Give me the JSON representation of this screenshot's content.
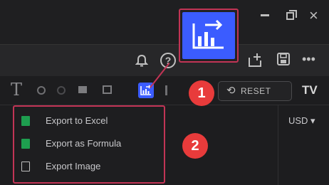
{
  "window": {
    "close_glyph": "×"
  },
  "actions": {
    "help_glyph": "?",
    "more_glyph": "•••"
  },
  "toolbar": {
    "text_tool_glyph": "T",
    "reset_icon_glyph": "⟲",
    "reset_label": "RESET",
    "logo_text": "TV"
  },
  "panel": {
    "currency_label": "USD ▾"
  },
  "export_menu": {
    "items": [
      {
        "label": "Export to Excel",
        "icon": "excel-icon"
      },
      {
        "label": "Export as Formula",
        "icon": "excel-icon"
      },
      {
        "label": "Export Image",
        "icon": "image-icon"
      }
    ]
  },
  "annotations": {
    "badge_1": "1",
    "badge_2": "2"
  },
  "colors": {
    "accent": "#3b5cff",
    "highlight": "#c23455",
    "badge": "#e83b3b",
    "excel": "#1e9e4f"
  }
}
